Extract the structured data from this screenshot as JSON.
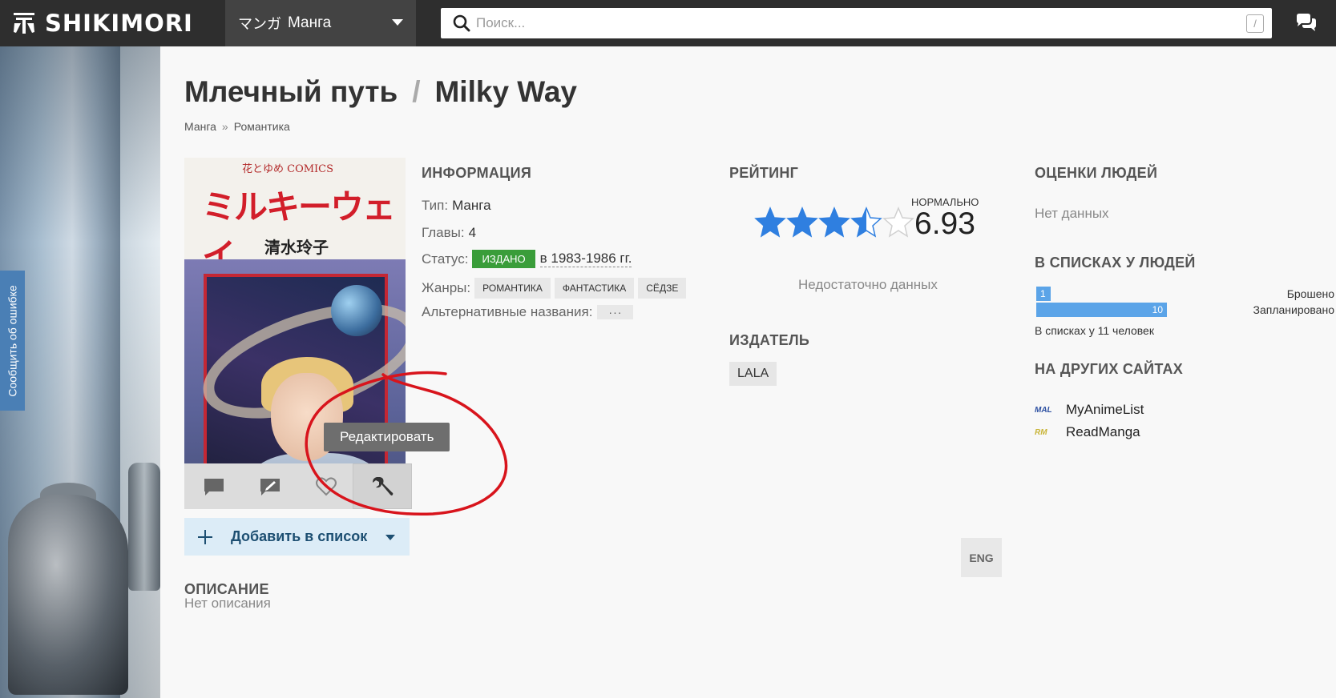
{
  "header": {
    "logo_text": "SHIKIMORI",
    "section_jp": "マンガ",
    "section_label": "Манга",
    "search_placeholder": "Поиск...",
    "search_hotkey": "/"
  },
  "sidebar": {
    "report_label": "Сообщить об ошибке"
  },
  "page": {
    "title_ru": "Млечный путь",
    "title_sep": "/",
    "title_en": "Milky Way",
    "breadcrumbs": [
      "Манга",
      "Романтика"
    ],
    "breadcrumb_sep": "»"
  },
  "poster": {
    "comics_label": "花とゆめ COMICS",
    "jp_title": "ミルキーウェイ",
    "jp_author": "清水玲子"
  },
  "actions": {
    "icons": [
      "comment-icon",
      "review-icon",
      "favorite-heart-icon",
      "wrench-icon"
    ],
    "tooltip": "Редактировать"
  },
  "add_to_list": {
    "label": "Добавить в список"
  },
  "info": {
    "header": "Информация",
    "type_label": "Тип:",
    "type_value": "Манга",
    "chapters_label": "Главы:",
    "chapters_value": "4",
    "status_label": "Статус:",
    "status_badge": "издано",
    "status_years": "в 1983-1986 гг.",
    "genres_label": "Жанры:",
    "genres": [
      "романтика",
      "фантастика",
      "сёдзе"
    ],
    "alt_names_label": "Альтернативные названия:",
    "alt_names_more": "···"
  },
  "rating": {
    "header": "Рейтинг",
    "score_label": "НОРМАЛЬНО",
    "score": "6.93",
    "stars_filled": 3.5,
    "stars_total": 5,
    "not_enough": "Недостаточно данных",
    "star_color": "#2f7fe0",
    "star_empty_color": "#d0d0d0"
  },
  "publisher": {
    "header": "Издатель",
    "name": "LALA"
  },
  "people_scores": {
    "header": "Оценки людей",
    "empty": "Нет данных"
  },
  "user_lists": {
    "header": "В списках у людей",
    "rows": [
      {
        "count": 1,
        "label": "Брошено",
        "fraction": 0.1
      },
      {
        "count": 10,
        "label": "Запланировано",
        "fraction": 1.0
      }
    ],
    "total": "В списках у 11 человек",
    "bar_color": "#5ba4e8"
  },
  "other_sites": {
    "header": "На других сайтах",
    "items": [
      {
        "icon": "MAL",
        "name": "MyAnimeList",
        "color": "#2e51a2"
      },
      {
        "icon": "RM",
        "name": "ReadManga",
        "color": "#c9b53a"
      }
    ]
  },
  "description": {
    "header": "Описание",
    "lang_button": "ENG",
    "empty": "Нет описания"
  },
  "annotation": {
    "color": "#d8141c"
  }
}
